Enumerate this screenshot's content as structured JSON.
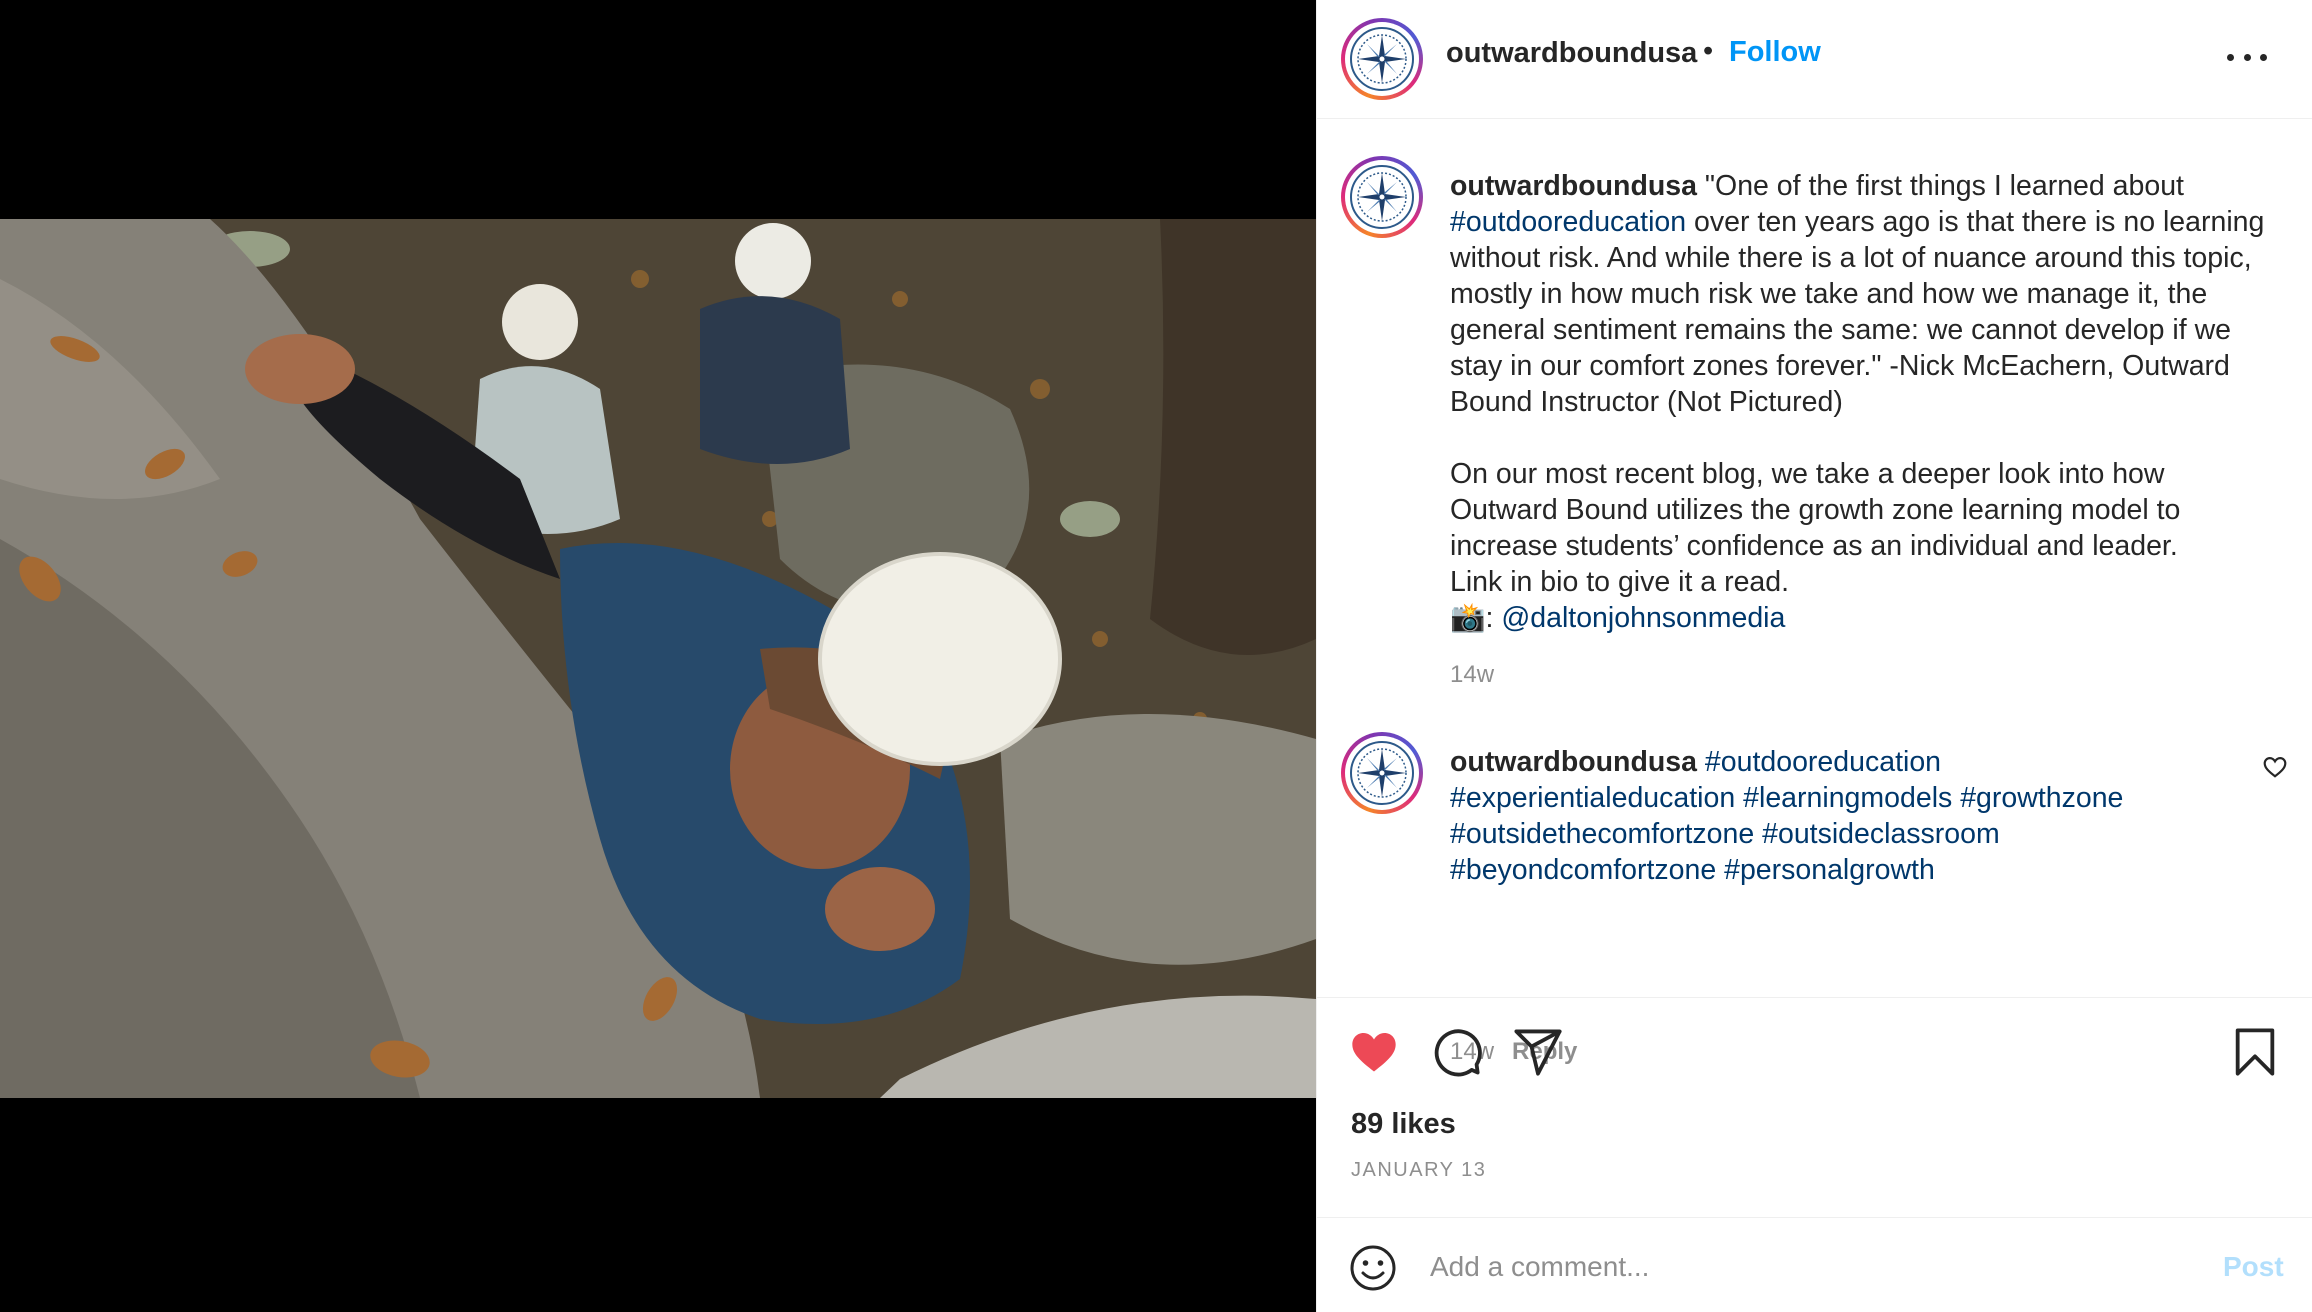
{
  "media": {
    "icon": "rock-climbing-photo"
  },
  "header": {
    "username": "outwardboundusa",
    "separator": "•",
    "follow_label": "Follow",
    "more_icon": "more-horizontal-icon"
  },
  "caption": {
    "username": "outwardboundusa",
    "text_1": "\"One of the first things I learned about ",
    "tag_1": "#outdooreducation",
    "text_2": " over ten years ago is that there is no learning without risk. And while there is a lot of nuance around this topic, mostly in how much risk we take and how we manage it, the general sentiment remains the same: we cannot develop if we stay in our comfort zones forever.\" -Nick McEachern, Outward Bound Instructor (Not Pictured)",
    "para_2": "On our most recent blog, we take a deeper look into how Outward Bound utilizes the growth zone learning model to increase students’ confidence as an individual and leader.",
    "para_3": "Link in bio to give it a read.",
    "credit_prefix": "📸: ",
    "credit_handle": "@daltonjohnsonmedia",
    "time": "14w"
  },
  "comment": {
    "username": "outwardboundusa",
    "tags": [
      "#outdooreducation",
      "#experientialeducation",
      "#learningmodels",
      "#growthzone",
      "#outsidethecomfortzone",
      "#outsideclassroom",
      "#beyondcomfortzone",
      "#personalgrowth"
    ],
    "time": "14w",
    "reply_label": "Reply"
  },
  "actions": {
    "liked": true,
    "like_color": "#ed4956",
    "likes_text": "89 likes",
    "date_text": "JANUARY 13"
  },
  "add_comment": {
    "placeholder": "Add a comment...",
    "post_label": "Post"
  },
  "colors": {
    "link": "#0095f6",
    "hashtag": "#00376b",
    "muted": "#8e8e8e"
  }
}
